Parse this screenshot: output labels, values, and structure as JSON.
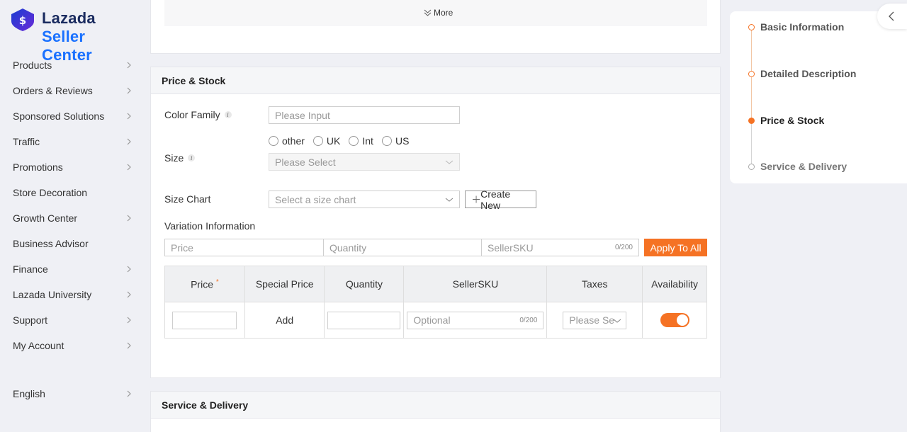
{
  "brand": {
    "line1": "Lazada",
    "line2": "Seller Center",
    "colors": {
      "navy": "#1a2b5f",
      "blue": "#1a71ff",
      "orange": "#f57224"
    }
  },
  "sidebar": {
    "items": [
      {
        "label": "Products",
        "has_chevron": true
      },
      {
        "label": "Orders & Reviews",
        "has_chevron": true
      },
      {
        "label": "Sponsored Solutions",
        "has_chevron": true
      },
      {
        "label": "Traffic",
        "has_chevron": true
      },
      {
        "label": "Promotions",
        "has_chevron": true
      },
      {
        "label": "Store Decoration",
        "has_chevron": false
      },
      {
        "label": "Growth Center",
        "has_chevron": true
      },
      {
        "label": "Business Advisor",
        "has_chevron": false
      },
      {
        "label": "Finance",
        "has_chevron": true
      },
      {
        "label": "Lazada University",
        "has_chevron": true
      },
      {
        "label": "Support",
        "has_chevron": true
      },
      {
        "label": "My Account",
        "has_chevron": true
      }
    ],
    "language": "English"
  },
  "top_card": {
    "more_label": "More"
  },
  "price_stock": {
    "title": "Price & Stock",
    "color_family": {
      "label": "Color Family",
      "placeholder": "Please Input"
    },
    "size": {
      "label": "Size",
      "options": [
        "other",
        "UK",
        "Int",
        "US"
      ],
      "select_placeholder": "Please Select"
    },
    "size_chart": {
      "label": "Size Chart",
      "placeholder": "Select a size chart",
      "create_label": "Create New"
    },
    "variation": {
      "label": "Variation Information",
      "price_placeholder": "Price",
      "quantity_placeholder": "Quantity",
      "sku_placeholder": "SellerSKU",
      "sku_counter": "0/200",
      "apply_label": "Apply To All"
    },
    "table": {
      "headers": [
        "Price",
        "Special Price",
        "Quantity",
        "SellerSKU",
        "Taxes",
        "Availability"
      ],
      "required_mark": "*",
      "row": {
        "special_price": "Add",
        "sku_placeholder": "Optional",
        "sku_counter": "0/200",
        "taxes_placeholder": "Please Se",
        "availability_on": true
      }
    }
  },
  "service_delivery": {
    "title": "Service & Delivery"
  },
  "steps": [
    {
      "label": "Basic Information",
      "state": "done"
    },
    {
      "label": "Detailed Description",
      "state": "done"
    },
    {
      "label": "Price & Stock",
      "state": "active"
    },
    {
      "label": "Service & Delivery",
      "state": "pending"
    }
  ],
  "icons": {
    "logo": "lazada-heart-logo-icon",
    "chevron": "chevron-right-icon",
    "more": "double-chevron-down-icon",
    "info": "info-icon",
    "select": "chevron-down-icon",
    "plus": "plus-icon",
    "collapse": "chevron-left-icon"
  }
}
